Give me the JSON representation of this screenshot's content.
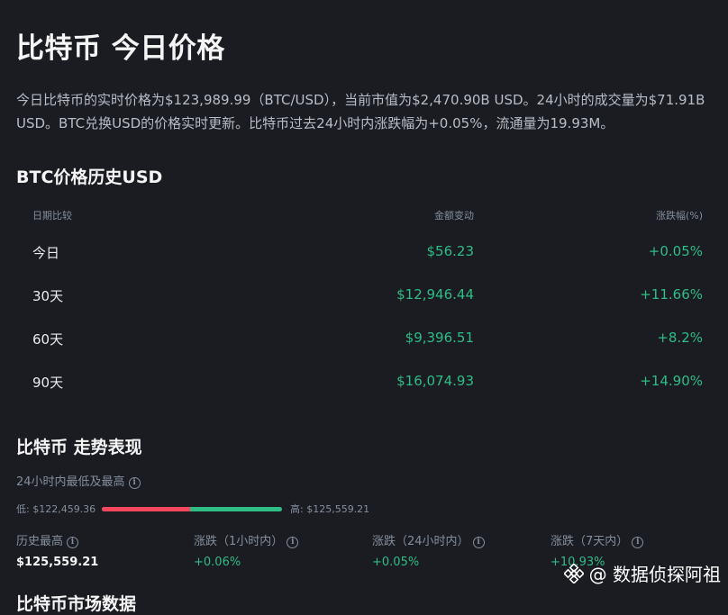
{
  "title": "比特币 今日价格",
  "description": "今日比特币的实时价格为$123,989.99（BTC/USD），当前市值为$2,470.90B USD。24小时的成交量为$71.91B USD。BTC兑换USD的价格实时更新。比特币过去24小时内涨跌幅为+0.05%，流通量为19.93M。",
  "history": {
    "title": "BTC价格历史USD",
    "headers": {
      "period": "日期比较",
      "amount": "金额变动",
      "pct": "涨跌幅(%)"
    },
    "rows": [
      {
        "period": "今日",
        "amount": "$56.23",
        "pct": "+0.05%"
      },
      {
        "period": "30天",
        "amount": "$12,946.44",
        "pct": "+11.66%"
      },
      {
        "period": "60天",
        "amount": "$9,396.51",
        "pct": "+8.2%"
      },
      {
        "period": "90天",
        "amount": "$16,074.93",
        "pct": "+14.90%"
      }
    ]
  },
  "performance": {
    "title": "比特币 走势表现",
    "range_label": "24小时内最低及最高",
    "low": "低: $122,459.36",
    "high": "高: $125,559.21",
    "range_fraction": 0.49,
    "stats": [
      {
        "label": "历史最高",
        "value": "$125,559.21"
      },
      {
        "label": "涨跌（1小时内）",
        "value": "+0.06%"
      },
      {
        "label": "涨跌（24小时内）",
        "value": "+0.05%"
      },
      {
        "label": "涨跌（7天内）",
        "value": "+10.93%"
      }
    ]
  },
  "next_section_title": "比特币市场数据",
  "watermark": "@ 数据侦探阿祖",
  "colors": {
    "up": "#2ebd85",
    "down": "#f6465d",
    "bg": "#1b1c22"
  }
}
